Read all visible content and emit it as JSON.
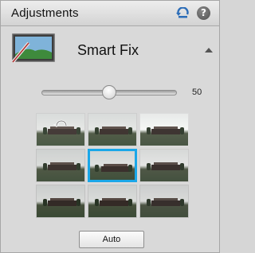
{
  "panel": {
    "title": "Adjustments",
    "undo_icon": "undo-arrow-icon",
    "help_icon": "help-icon",
    "help_glyph": "?"
  },
  "section": {
    "title": "Smart Fix",
    "icon": "smart-fix-icon",
    "collapse_icon": "triangle-up-icon"
  },
  "slider": {
    "value": "50",
    "fraction": 0.5
  },
  "thumbnails": {
    "count": 9,
    "selected_index": 4,
    "reset_icon": "reset-arrow-icon",
    "selection_color": "#1aa7e8"
  },
  "buttons": {
    "auto_label": "Auto"
  }
}
